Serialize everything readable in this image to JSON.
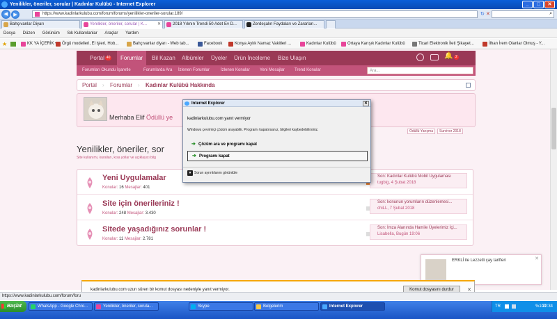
{
  "window": {
    "title": "Yenilikler, öneriler, sorular | Kadınlar Kulübü - Internet Explorer"
  },
  "address": {
    "url": "https://www.kadinlarkulubu.com/forum/forums/yenilikler-oneriler-sorular.189/"
  },
  "tabs": [
    {
      "label": "Bahçıvanlar Diyarı",
      "color": "#d8a64a"
    },
    {
      "label": "Yenilikler, öneriler, sorular | K...",
      "color": "#e8459a",
      "active": true
    },
    {
      "label": "2018 Yılının Trendi 50 Adet Ev D...",
      "color": "#e8459a"
    },
    {
      "label": "Zerdeçalın Faydaları ve Zararları...",
      "color": "#222222"
    }
  ],
  "menu": [
    "Dosya",
    "Düzen",
    "Görünüm",
    "Sık Kullanılanlar",
    "Araçlar",
    "Yardım"
  ],
  "favorites": [
    {
      "label": "KK YA İÇERİK",
      "color": "#e8459a"
    },
    {
      "label": "Örgü modelleri, El işleri, Hob...",
      "color": "#c0392b"
    },
    {
      "label": "Bahçıvanlar diyarı - Web tab...",
      "color": "#d8a64a"
    },
    {
      "label": "Facebook",
      "color": "#3b5998"
    },
    {
      "label": "Konya Aylık Namaz Vakitleri ...",
      "color": "#c0392b"
    },
    {
      "label": "Kadınlar Kulübü",
      "color": "#e8459a"
    },
    {
      "label": "Ortaya Karışık Kadınlar Kulübü",
      "color": "#e8459a"
    },
    {
      "label": "Ticari Elektronik İleti Şikayet...",
      "color": "#777777"
    },
    {
      "label": "İlhan İrem Olanlar Olmuş - Y...",
      "color": "#c0392b"
    }
  ],
  "site": {
    "nav1": [
      {
        "label": "Portal",
        "badge": "40"
      },
      {
        "label": "Forumlar",
        "active": true
      },
      {
        "label": "Bil Kazan"
      },
      {
        "label": "Albümler"
      },
      {
        "label": "Üyeler"
      },
      {
        "label": "Ürün İnceleme"
      },
      {
        "label": "Bize Ulaşın"
      }
    ],
    "nav1_badge_count": "2",
    "nav2": [
      "Forumları Okundu İşaretle",
      "Forumlarda Ara",
      "İzlenen Forumlar",
      "İzlenen Konular",
      "Yeni Mesajlar",
      "Trend Konular"
    ],
    "search_placeholder": "Ara...",
    "breadcrumbs": [
      "Portal",
      "Forumlar",
      "Kadınlar Kulübü Hakkında"
    ],
    "welcome": {
      "prefix": "Merhaba Elif",
      "link": "Ödüllü ye"
    },
    "welcome_tags": [
      "Ödüllü Yarışma",
      "Survivor 2018"
    ],
    "section_title": "Yenilikler, öneriler, sor",
    "section_sub": "Site kullanımı, kuralları, kısa yollar ve açıklayıcı bilg",
    "forums": [
      {
        "title": "Yeni Uygulamalar",
        "topics_label": "Konular:",
        "topics": "16",
        "messages_label": "Mesajlar:",
        "messages": "401",
        "last_title": "Son: Kadınlar Kulübü Mobil Uygulaması",
        "last_meta": "tugbig, 4 Şubat 2018"
      },
      {
        "title": "Site için önerileriniz !",
        "topics_label": "Konular:",
        "topics": "248",
        "messages_label": "Mesajlar:",
        "messages": "3.430",
        "last_title": "Son: konunun yorumların düzenlemesi...",
        "last_meta": "chiLL, 7 Şubat 2018"
      },
      {
        "title": "Sitede yaşadığınız sorunlar !",
        "topics_label": "Konular:",
        "topics": "11",
        "messages_label": "Mesajlar:",
        "messages": "2.781",
        "last_title": "Son: İmza Alanında Hamile Üyelerimiz İçi...",
        "last_meta": "Lisabella, Bugün 19:06"
      }
    ],
    "toast": "ERKLİ ile Lezzetli çay tarifleri"
  },
  "dialog": {
    "title": "Internet Explorer",
    "heading": "kadinlarkulubu.com yanıt vermiyor",
    "message": "Windows çevrimiçi çözüm arayabilir. Programı kapatırsanız, bilgileri kaybedebilirsiniz.",
    "option1": "Çözüm ara ve programı kapat",
    "option2": "Programı kapat",
    "details": "Sorun ayrıntılarını görüntüle"
  },
  "notification": {
    "text": "kadinlarkulubu.com uzun süren bir komut dosyası nedeniyle yanıt vermiyor.",
    "button": "Komut dosyasını durdur"
  },
  "status": {
    "text": "https://www.kadinlarkulubu.com/forum/foru"
  },
  "taskbar": {
    "start": "Başlat",
    "items": [
      {
        "label": "WhatsApp - Google Chro...",
        "color": "#25d366"
      },
      {
        "label": "Yenilikler, öneriler, sorula...",
        "color": "#e8459a"
      },
      {
        "label": "Skype",
        "color": "#00aff0"
      },
      {
        "label": "Belgelerim",
        "color": "#f3c74b"
      },
      {
        "label": "Internet Explorer",
        "color": "#4aa8ff",
        "active": true
      }
    ],
    "lang": "TR",
    "volume": "%100",
    "clock": "22:34"
  }
}
